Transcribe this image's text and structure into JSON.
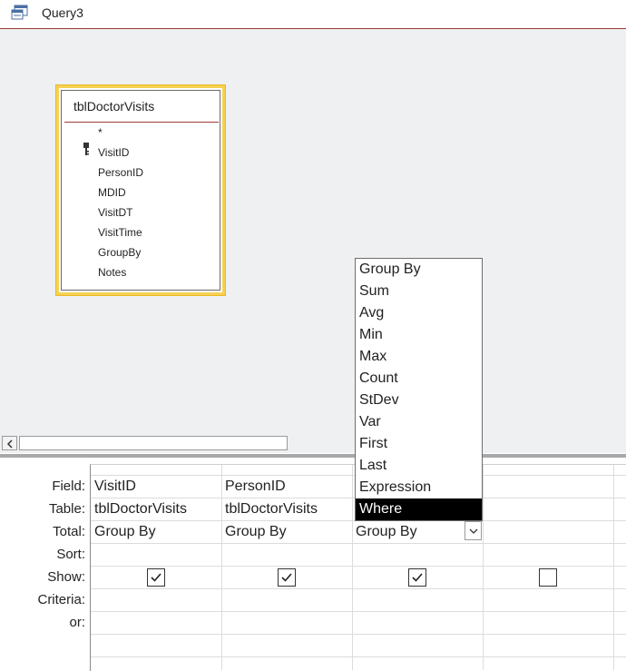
{
  "window": {
    "title": "Query3",
    "icon": "query-icon"
  },
  "table": {
    "name": "tblDoctorVisits",
    "fields": [
      "*",
      "VisitID",
      "PersonID",
      "MDID",
      "VisitDT",
      "VisitTime",
      "GroupBy",
      "Notes"
    ],
    "primary_key": "VisitID",
    "key_icon": "primary-key-icon"
  },
  "grid": {
    "row_labels": [
      "Field:",
      "Table:",
      "Total:",
      "Sort:",
      "Show:",
      "Criteria:",
      "or:"
    ],
    "columns": [
      {
        "field": "VisitID",
        "table": "tblDoctorVisits",
        "total": "Group By",
        "show": true
      },
      {
        "field": "PersonID",
        "table": "tblDoctorVisits",
        "total": "Group By",
        "show": true
      },
      {
        "field": "",
        "table": "",
        "total": "Group By",
        "show": true
      },
      {
        "field": "",
        "table": "",
        "total": "",
        "show": false
      }
    ]
  },
  "dropdown": {
    "options": [
      "Group By",
      "Sum",
      "Avg",
      "Min",
      "Max",
      "Count",
      "StDev",
      "Var",
      "First",
      "Last",
      "Expression",
      "Where"
    ],
    "selected": "Where"
  },
  "colors": {
    "table_highlight": "#f7d154",
    "title_rule": "#9b3a3a",
    "selected_bg": "#000000"
  }
}
